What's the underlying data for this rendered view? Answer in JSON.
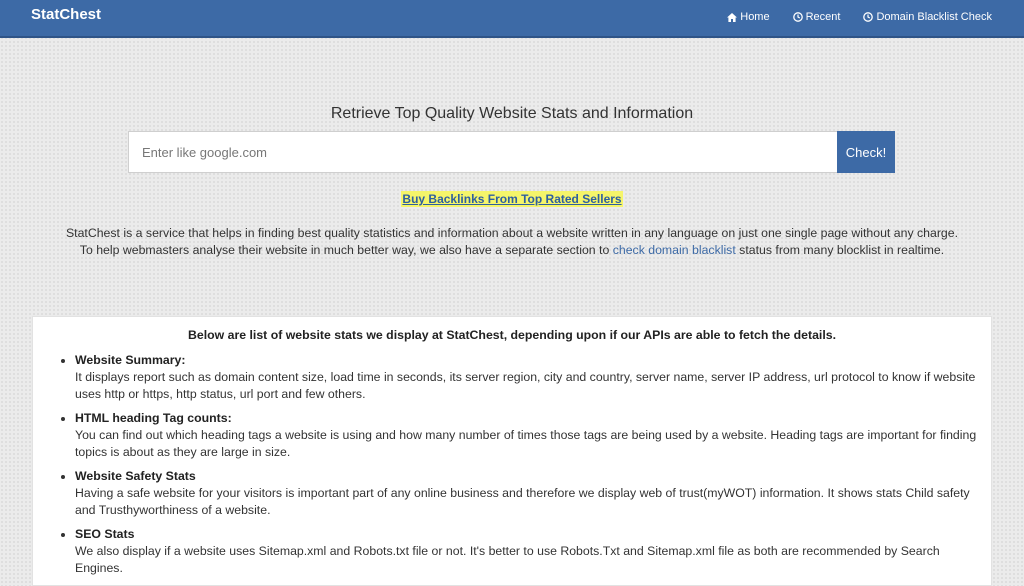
{
  "brand": "StatChest",
  "nav": {
    "home": "Home",
    "recent": "Recent",
    "blacklist": "Domain Blacklist Check"
  },
  "headline": "Retrieve Top Quality Website Stats and Information",
  "search": {
    "placeholder": "Enter like google.com",
    "value": "",
    "button": "Check!"
  },
  "promo": "Buy Backlinks From Top Rated Sellers",
  "intro": {
    "line1": "StatChest is a service that helps in finding best quality statistics and information about a website written in any language on just one single page without any charge.",
    "line2_before": "To help webmasters analyse their website in much better way, we also have a separate section to",
    "line2_link": "check domain blacklist",
    "line2_after": "status from many blocklist in realtime."
  },
  "panel": {
    "heading": "Below are list of website stats we display at StatChest, depending upon if our APIs are able to fetch the details.",
    "features": [
      {
        "title": "Website Summary:",
        "desc": "It displays report such as domain content size, load time in seconds, its server region, city and country, server name, server IP address, url protocol to know if website uses http or https, http status, url port and few others."
      },
      {
        "title": "HTML heading Tag counts:",
        "desc": "You can find out which heading tags a website is using and how many number of times those tags are being used by a website. Heading tags are important for finding topics is about as they are large in size."
      },
      {
        "title": "Website Safety Stats",
        "desc": "Having a safe website for your visitors is important part of any online business and therefore we display web of trust(myWOT) information. It shows stats Child safety and Trusthyworthiness of a website."
      },
      {
        "title": "SEO Stats",
        "desc": "We also display if a website uses Sitemap.xml and Robots.txt file or not. It's better to use Robots.Txt and Sitemap.xml file as both are recommended by Search Engines."
      }
    ]
  },
  "colors": {
    "primary": "#3d6aa6",
    "highlight": "#f5f56a"
  }
}
